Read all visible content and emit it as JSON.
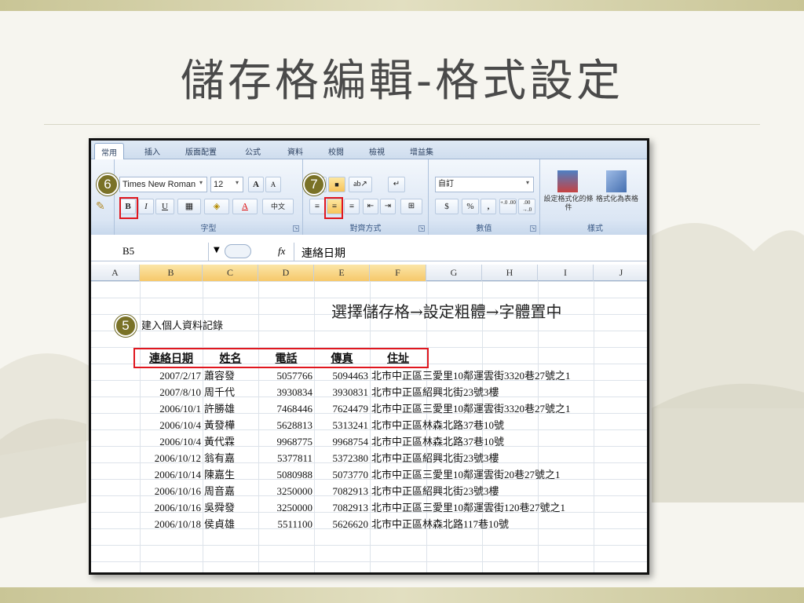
{
  "slide": {
    "title": "儲存格編輯-格式設定"
  },
  "ribbon": {
    "tabs": [
      "常用",
      "插入",
      "版面配置",
      "公式",
      "資料",
      "校閱",
      "檢視",
      "增益集"
    ],
    "font_name": "Times New Roman",
    "font_size": "12",
    "grow_font": "A",
    "shrink_font": "A",
    "bold_label": "B",
    "italic_label": "I",
    "underline_label": "U",
    "font_color_label": "A",
    "phonetic_label": "中文",
    "number_format": "自訂",
    "currency_label": "$",
    "percent_label": "%",
    "comma_label": ",",
    "inc_decimal_label": "+.0 .00",
    "dec_decimal_label": ".00 →.0",
    "conditional_format_label": "設定格式化的條件",
    "format_as_table_label": "格式化為表格",
    "group_font_label": "字型",
    "group_align_label": "對齊方式",
    "group_number_label": "數值",
    "group_styles_label": "樣式"
  },
  "badges": {
    "five": "5",
    "six": "6",
    "seven": "7"
  },
  "formula_bar": {
    "cell_ref": "B5",
    "fx_label": "fx",
    "content": "連絡日期"
  },
  "columns": [
    "A",
    "B",
    "C",
    "D",
    "E",
    "F",
    "G",
    "H",
    "I",
    "J"
  ],
  "sheet": {
    "instruction": "選擇儲存格→設定粗體→字體置中",
    "section_title": "建入個人資料記錄",
    "headers": [
      "連絡日期",
      "姓名",
      "電話",
      "傳真",
      "住址"
    ],
    "rows": [
      [
        "2007/2/17",
        "蕭容發",
        "5057766",
        "5094463",
        "北市中正區三愛里10鄰運雲街3320巷27號之1"
      ],
      [
        "2007/8/10",
        "周千代",
        "3930834",
        "3930831",
        "北市中正區紹興北街23號3樓"
      ],
      [
        "2006/10/1",
        "許勝雄",
        "7468446",
        "7624479",
        "北市中正區三愛里10鄰運雲街3320巷27號之1"
      ],
      [
        "2006/10/4",
        "黃發樺",
        "5628813",
        "5313241",
        "北市中正區林森北路37巷10號"
      ],
      [
        "2006/10/4",
        "黃代霖",
        "9968775",
        "9968754",
        "北市中正區林森北路37巷10號"
      ],
      [
        "2006/10/12",
        "翁有嘉",
        "5377811",
        "5372380",
        "北市中正區紹興北街23號3樓"
      ],
      [
        "2006/10/14",
        "陳嘉生",
        "5080988",
        "5073770",
        "北市中正區三愛里10鄰運雲街20巷27號之1"
      ],
      [
        "2006/10/16",
        "周音嘉",
        "3250000",
        "7082913",
        "北市中正區紹興北街23號3樓"
      ],
      [
        "2006/10/16",
        "吳舜發",
        "3250000",
        "7082913",
        "北市中正區三愛里10鄰運雲街120巷27號之1"
      ],
      [
        "2006/10/18",
        "侯貞雄",
        "5511100",
        "5626620",
        "北市中正區林森北路117巷10號"
      ]
    ]
  }
}
